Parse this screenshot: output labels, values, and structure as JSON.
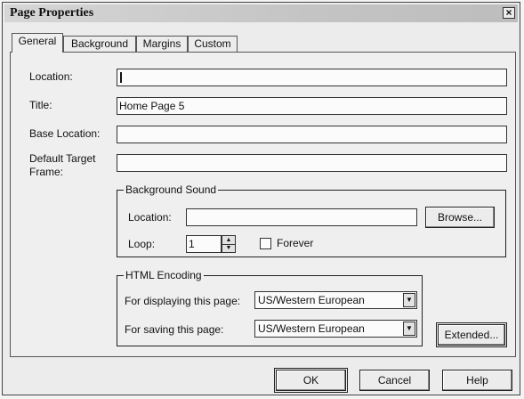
{
  "window": {
    "title": "Page Properties"
  },
  "tabs": [
    {
      "label": "General",
      "active": true
    },
    {
      "label": "Background",
      "active": false
    },
    {
      "label": "Margins",
      "active": false
    },
    {
      "label": "Custom",
      "active": false
    }
  ],
  "fields": {
    "location": {
      "label": "Location:",
      "value": ""
    },
    "title": {
      "label": "Title:",
      "value": "Home Page 5"
    },
    "base_location": {
      "label": "Base Location:",
      "value": ""
    },
    "default_target_frame": {
      "label_line1": "Default Target",
      "label_line2": "Frame:",
      "value": ""
    }
  },
  "background_sound": {
    "group_label": "Background Sound",
    "location_label": "Location:",
    "location_value": "",
    "browse_label": "Browse...",
    "loop_label": "Loop:",
    "loop_value": "1",
    "forever_label": "Forever",
    "forever_checked": false
  },
  "html_encoding": {
    "group_label": "HTML Encoding",
    "display_label": "For displaying this page:",
    "display_value": "US/Western European",
    "save_label": "For saving this page:",
    "save_value": "US/Western European",
    "extended_label": "Extended..."
  },
  "buttons": {
    "ok": "OK",
    "cancel": "Cancel",
    "help": "Help"
  },
  "icons": {
    "close": "close-icon",
    "spin_up": "spin-up-icon",
    "spin_down": "spin-down-icon",
    "dropdown": "chevron-down-icon"
  }
}
